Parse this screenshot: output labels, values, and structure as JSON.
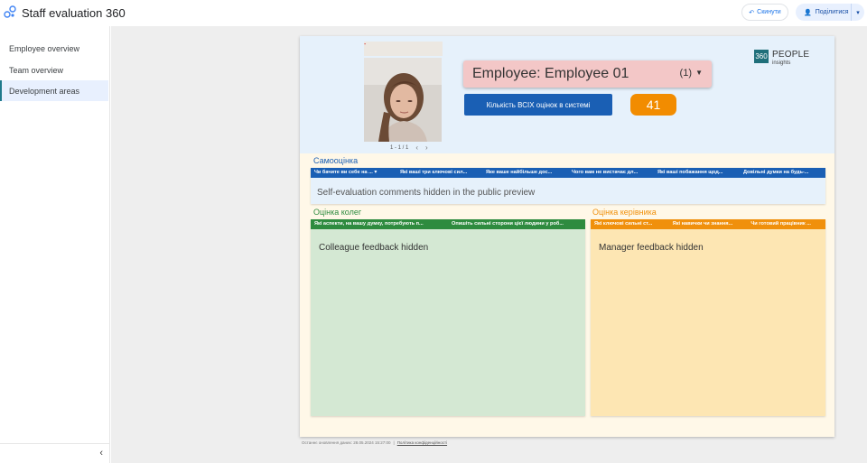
{
  "app": {
    "title": "Staff evaluation 360"
  },
  "toolbar": {
    "reset_label": "Скинути",
    "share_label": "Поділитися"
  },
  "sidebar": {
    "items": [
      {
        "label": "Employee overview"
      },
      {
        "label": "Team overview"
      },
      {
        "label": "Development areas",
        "active": true
      }
    ]
  },
  "report": {
    "photo_caption": "-",
    "pager": "1 - 1 / 1",
    "employee_select": {
      "value": "Employee: Employee 01",
      "count": "(1)"
    },
    "total_button_label": "Кількість ВСІХ оцінок в системі",
    "total_value": "41",
    "brand": {
      "code": "360",
      "name": "PEOPLE",
      "sub": "insights"
    },
    "self": {
      "title": "Самооцінка",
      "columns": [
        "Чи бачите ви себе на ...",
        "Які ваші три ключові сил...",
        "Яке ваше найбільше дос...",
        "Чого вам не вистачає дл...",
        "Які ваші побажання щод...",
        "Довільні думки на будь-..."
      ],
      "message": "Self-evaluation comments hidden in the public preview"
    },
    "colleagues": {
      "title": "Оцінка колег",
      "columns": [
        "Які аспекти, на вашу думку, потребують п...",
        "Опишіть сильні сторони цієї людини у роб..."
      ],
      "message": "Colleague feedback hidden"
    },
    "manager": {
      "title": "Оцінка керівника",
      "columns": [
        "Які ключові сильні ст...",
        "Які навички чи знання...",
        "Чи готовий працівник ..."
      ],
      "message": "Manager feedback hidden"
    },
    "footer": {
      "updated": "Останнє оновлення даних: 28.05.2024 15:27:00",
      "privacy": "Політика конфіденційності"
    }
  },
  "colors": {
    "self": "#1a5fb4",
    "colleagues": "#2e8b3f",
    "manager": "#f0900c",
    "count": "#f28c00"
  }
}
